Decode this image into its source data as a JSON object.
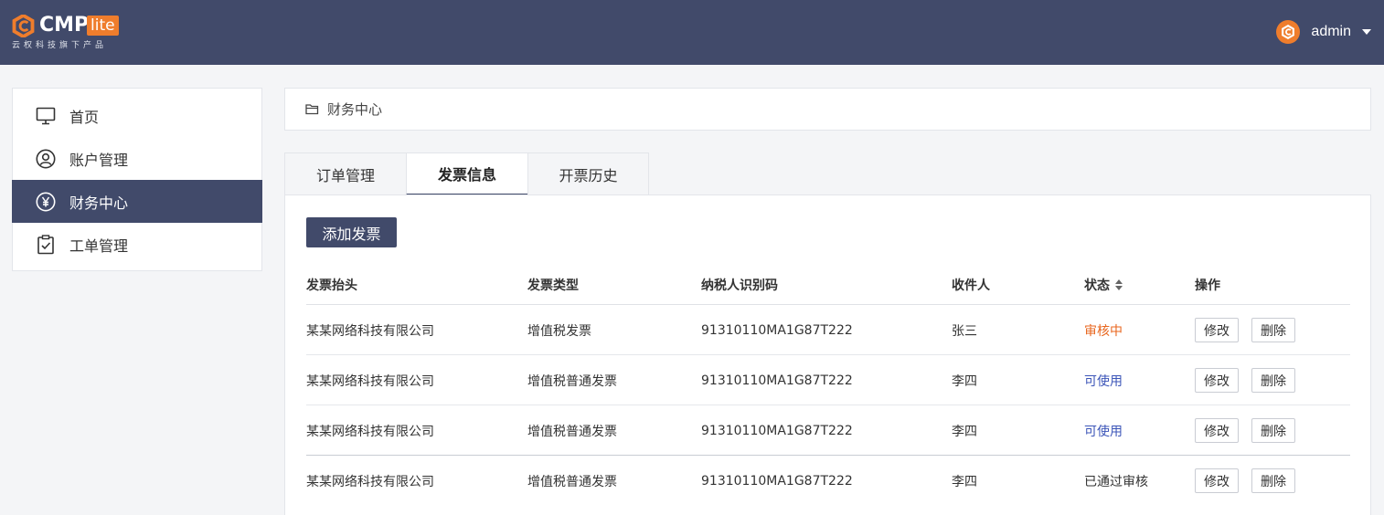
{
  "header": {
    "brand": "CMP",
    "brand_badge": "lite",
    "tagline": "云权科技旗下产品",
    "user_name": "admin"
  },
  "sidebar": {
    "items": [
      {
        "label": "首页",
        "icon": "monitor-icon"
      },
      {
        "label": "账户管理",
        "icon": "user-circle-icon"
      },
      {
        "label": "财务中心",
        "icon": "yen-circle-icon",
        "active": true
      },
      {
        "label": "工单管理",
        "icon": "clipboard-check-icon"
      }
    ]
  },
  "breadcrumb": {
    "icon": "folder-icon",
    "label": "财务中心"
  },
  "tabs": [
    {
      "label": "订单管理"
    },
    {
      "label": "发票信息",
      "active": true
    },
    {
      "label": "开票历史"
    }
  ],
  "toolbar": {
    "add_label": "添加发票"
  },
  "table": {
    "columns": [
      "发票抬头",
      "发票类型",
      "纳税人识别码",
      "收件人",
      "状态",
      "操作"
    ],
    "rows": [
      {
        "title": "某某网络科技有限公司",
        "type": "增值税发票",
        "tax_id": "91310110MA1G87T222",
        "recipient": "张三",
        "status": "审核中",
        "edit": "修改",
        "delete": "删除"
      },
      {
        "title": "某某网络科技有限公司",
        "type": "增值税普通发票",
        "tax_id": "91310110MA1G87T222",
        "recipient": "李四",
        "status": "可使用",
        "edit": "修改",
        "delete": "删除"
      },
      {
        "title": "某某网络科技有限公司",
        "type": "增值税普通发票",
        "tax_id": "91310110MA1G87T222",
        "recipient": "李四",
        "status": "可使用",
        "edit": "修改",
        "delete": "删除"
      },
      {
        "title": "某某网络科技有限公司",
        "type": "增值税普通发票",
        "tax_id": "91310110MA1G87T222",
        "recipient": "李四",
        "status": "已通过审核",
        "edit": "修改",
        "delete": "删除"
      }
    ]
  },
  "colors": {
    "header_bg": "#414a6a",
    "accent": "#ef7d2c",
    "status_pending": "#e8661e",
    "status_available": "#3c55b8"
  }
}
